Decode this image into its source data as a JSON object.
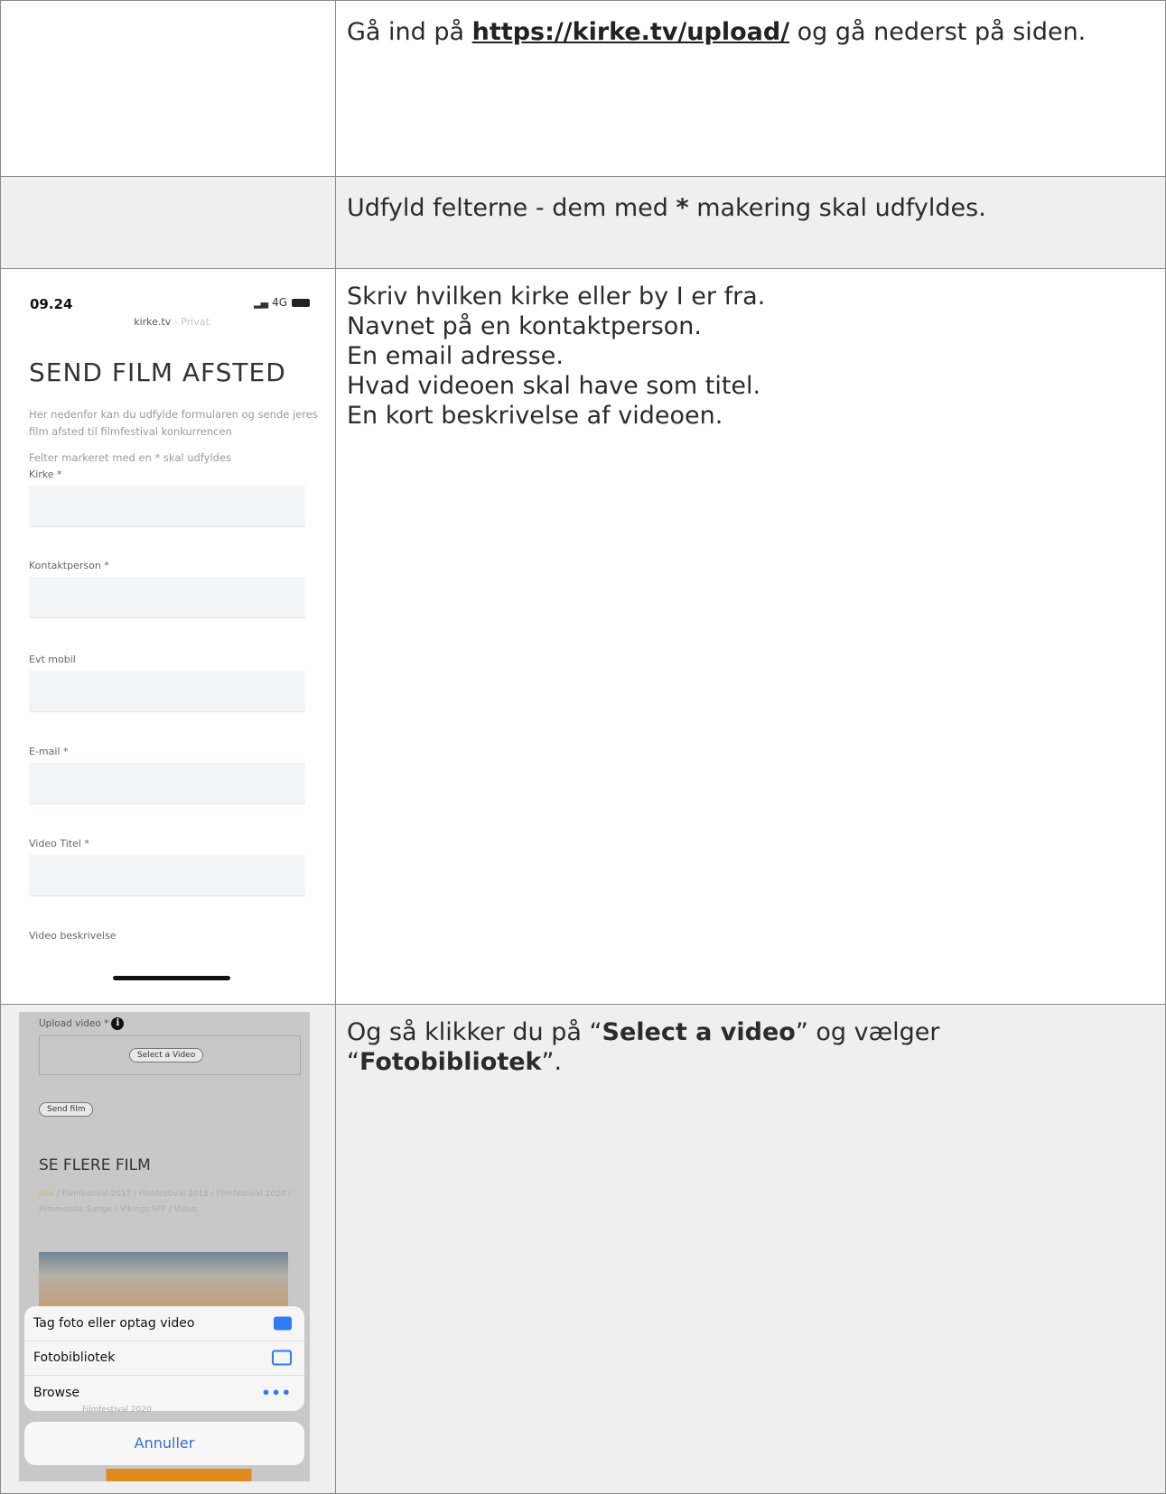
{
  "rows": [
    {
      "text_before": "Gå ind på ",
      "link": "https://kirke.tv/upload/",
      "text_after": " og gå nederst på siden."
    },
    {
      "text_before": "Udfyld felterne - dem med ",
      "bold": "*",
      "text_after": " makering skal udfyldes."
    },
    {
      "lines": [
        "Skriv hvilken kirke eller by I er fra.",
        "Navnet på en kontaktperson.",
        "En email adresse.",
        "Hvad videoen skal have som titel.",
        "En kort beskrivelse af videoen."
      ]
    },
    {
      "part1": "Og så klikker du på “",
      "bold1": "Select a video",
      "part2": "” og vælger “",
      "bold2": "Fotobibliotek",
      "part3": "”."
    }
  ],
  "phone1": {
    "time": "09.24",
    "network": "4G",
    "url": "kirke.tv",
    "url_suffix": "- Privat",
    "heading": "SEND FILM AFSTED",
    "intro": "Her nedenfor kan du udfylde formularen og sende jeres film afsted til filmfestival konkurrencen",
    "required_note": "Felter markeret med en * skal udfyldes",
    "fields": [
      "Kirke *",
      "Kontaktperson *",
      "Evt mobil",
      "E-mail *",
      "Video Titel *",
      "Video beskrivelse"
    ]
  },
  "phone2": {
    "upload_label": "Upload video *",
    "select_button": "Select a Video",
    "send_button": "Send film",
    "heading": "SE FLERE FILM",
    "cat_all": "Alle",
    "cats": " / Filmfestival 2017 / Filmfestival 2018 / Filmfestival 2020 / Himmelske Sange / Vikings SFF / Video",
    "sheet_options": [
      {
        "label": "Tag foto eller optag video",
        "icon": "camera-icon"
      },
      {
        "label": "Fotobibliotek",
        "icon": "folder-icon"
      },
      {
        "label": "Browse",
        "icon": "more-dots-icon"
      }
    ],
    "peek_text": "Filmfestival 2020",
    "cancel": "Annuller"
  },
  "colors": {
    "link_blue": "#2f6fd6",
    "icon_blue": "#2f7bf5",
    "category_highlight": "#d7b34e",
    "row_alt_bg": "#efefef"
  }
}
